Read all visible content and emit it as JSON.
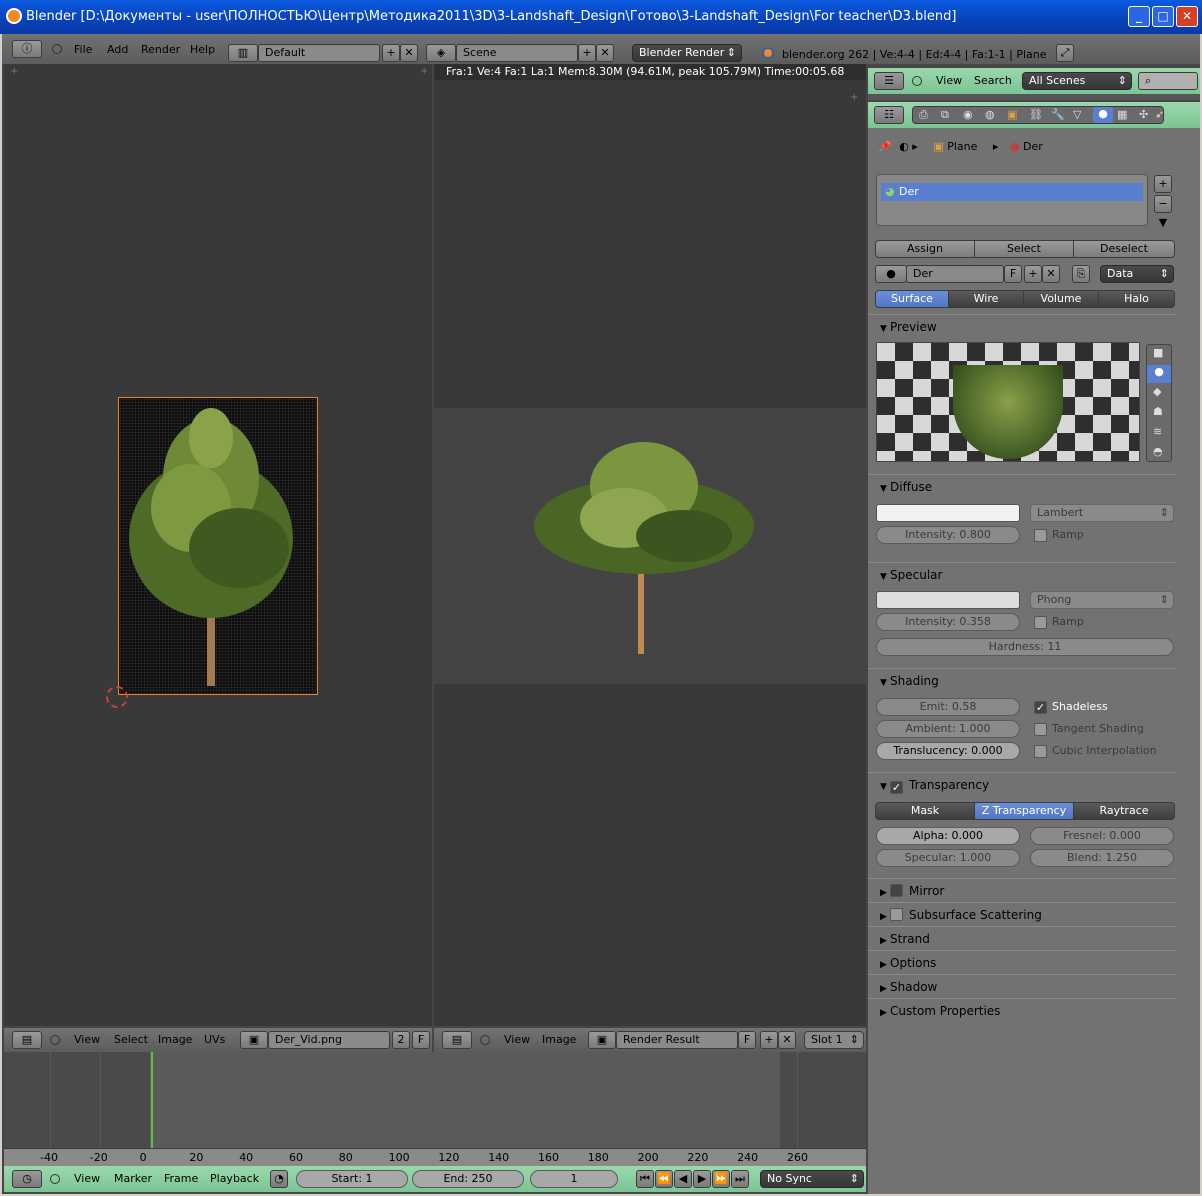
{
  "window": {
    "title": "Blender [D:\\Документы - user\\ПОЛНОСТЬЮ\\Центр\\Методика2011\\3D\\3-Landshaft_Design\\Готово\\3-Landshaft_Design\\For teacher\\D3.blend]",
    "minimize": "_",
    "maximize": "□",
    "close": "✕"
  },
  "top_header": {
    "menus": [
      "File",
      "Add",
      "Render",
      "Help"
    ],
    "screen_layout": "Default",
    "scene": "Scene",
    "render_engine": "Blender Render",
    "stats": "blender.org 262 | Ve:4-4 | Ed:4-4 | Fa:1-1 | Plane"
  },
  "render_view": {
    "info": "Fra:1  Ve:4 Fa:1 La:1 Mem:8.30M (94.61M, peak 105.79M) Time:00:05.68"
  },
  "uv_editor_header": {
    "menus": [
      "View",
      "Select",
      "Image",
      "UVs"
    ],
    "image_name": "Der_Vid.png",
    "users": "2",
    "fake": "F"
  },
  "image_editor_header": {
    "menus": [
      "View",
      "Image"
    ],
    "image_name": "Render Result",
    "fake": "F",
    "slot": "Slot 1"
  },
  "outliner_header": {
    "menus": [
      "View",
      "Search"
    ],
    "filter": "All Scenes"
  },
  "properties": {
    "breadcrumb": {
      "object": "Plane",
      "material": "Der"
    },
    "slot_list": [
      "Der"
    ],
    "assign": "Assign",
    "select": "Select",
    "deselect": "Deselect",
    "material_name": "Der",
    "fake_user": "F",
    "link": "Data",
    "type_tabs": [
      "Surface",
      "Wire",
      "Volume",
      "Halo"
    ],
    "type_selected": "Surface",
    "preview_title": "Preview",
    "diffuse": {
      "title": "Diffuse",
      "shader": "Lambert",
      "intensity": "Intensity: 0.800",
      "intensity_value": 0.8,
      "ramp": "Ramp"
    },
    "specular": {
      "title": "Specular",
      "shader": "Phong",
      "intensity": "Intensity: 0.358",
      "intensity_value": 0.358,
      "ramp": "Ramp",
      "hardness": "Hardness: 11"
    },
    "shading": {
      "title": "Shading",
      "emit": "Emit: 0.58",
      "ambient": "Ambient: 1.000",
      "translucency": "Translucency: 0.000",
      "shadeless": "Shadeless",
      "tangent": "Tangent Shading",
      "cubic": "Cubic Interpolation"
    },
    "transparency": {
      "title": "Transparency",
      "modes": [
        "Mask",
        "Z Transparency",
        "Raytrace"
      ],
      "selected": "Z Transparency",
      "alpha": "Alpha: 0.000",
      "fresnel": "Fresnel: 0.000",
      "specular": "Specular: 1.000",
      "blend": "Blend: 1.250"
    },
    "collapsed_panels": [
      "Mirror",
      "Subsurface Scattering",
      "Strand",
      "Options",
      "Shadow",
      "Custom Properties"
    ]
  },
  "timeline": {
    "ticks": [
      "-40",
      "-20",
      "0",
      "20",
      "40",
      "60",
      "80",
      "100",
      "120",
      "140",
      "160",
      "180",
      "200",
      "220",
      "240",
      "260"
    ],
    "menus": [
      "View",
      "Marker",
      "Frame",
      "Playback"
    ],
    "start": "Start: 1",
    "end": "End: 250",
    "current": "1",
    "sync": "No Sync",
    "current_frame": 1
  },
  "colors": {
    "selection_blue": "#5a7fd0",
    "timeline_header_green": "#8fd0a4",
    "outliner_header_green": "#8fd0a4",
    "current_frame_line": "#60c040"
  }
}
